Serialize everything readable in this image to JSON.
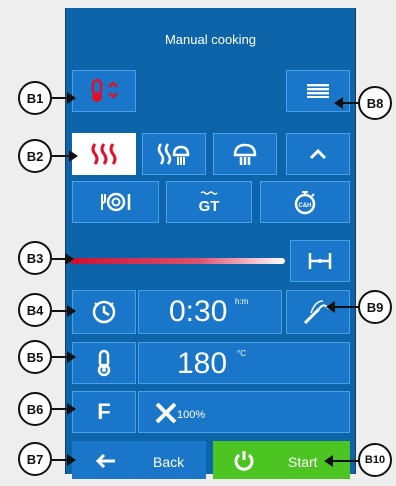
{
  "title": "Manual cooking",
  "time": {
    "value": "0:30",
    "unit": "h:m"
  },
  "temperature": {
    "value": "180",
    "unit": "°C"
  },
  "mode": {
    "label": "F",
    "fan_speed": "100%"
  },
  "footer": {
    "back_label": "Back",
    "start_label": "Start"
  },
  "callouts": {
    "b1": "B1",
    "b2": "B2",
    "b3": "B3",
    "b4": "B4",
    "b5": "B5",
    "b6": "B6",
    "b7": "B7",
    "b8": "B8",
    "b9": "B9",
    "b10": "B10"
  },
  "icons": {
    "mode_selector": "thermometer-updown-icon",
    "menu": "menu-lines-icon",
    "convection": "convection-heat-icon",
    "combi": "combi-steam-heat-icon",
    "steam": "steam-icon",
    "collapse": "chevron-up-icon",
    "plate": "plate-icon",
    "gt": "gt-icon",
    "cook_hold": "cook-hold-timer-icon",
    "span": "span-icon",
    "clock": "clock-icon",
    "probe": "core-probe-icon",
    "thermometer": "thermometer-icon",
    "fan": "fan-icon",
    "back_arrow": "arrow-left-icon",
    "power": "power-icon"
  },
  "colors": {
    "background": "#0e64a8",
    "button": "#1976c8",
    "accent_red": "#e0112b",
    "start": "#4cc421"
  }
}
